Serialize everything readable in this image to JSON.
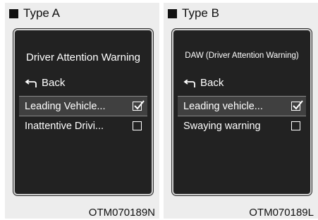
{
  "panels": [
    {
      "header": "Type A",
      "screen_title": "Driver Attention Warning",
      "back_label": "Back",
      "items": [
        {
          "label": "Leading Vehicle...",
          "checked": true
        },
        {
          "label": "Inattentive Drivi...",
          "checked": false
        }
      ],
      "caption": "OTM070189N"
    },
    {
      "header": "Type B",
      "screen_title": "DAW (Driver Attention Warning)",
      "back_label": "Back",
      "items": [
        {
          "label": "Leading vehicle...",
          "checked": true
        },
        {
          "label": "Swaying warning",
          "checked": false
        }
      ],
      "caption": "OTM070189L"
    }
  ],
  "colors": {
    "screen_bg": "#222222",
    "selected_row": "#404040",
    "panel_bg": "#ededed"
  },
  "icons": [
    "square-icon",
    "back-arrow-icon",
    "checkbox-checked-icon",
    "checkbox-empty-icon"
  ]
}
